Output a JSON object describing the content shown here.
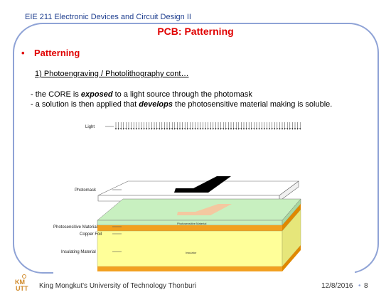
{
  "header": {
    "course": "EIE 211 Electronic Devices and Circuit Design II"
  },
  "slide": {
    "title": "PCB: Patterning",
    "bullet_marker": "•",
    "bullet": "Patterning",
    "subheading": "1)  Photoengraving / Photolithography cont…",
    "line1": {
      "prefix": "- the CORE is ",
      "emph": "exposed",
      "suffix": " to a light source through the photomask"
    },
    "line2": {
      "prefix": "- a solution is then applied that ",
      "emph": "develops",
      "suffix": " the photosensitive material making is soluble."
    }
  },
  "figure": {
    "labels": {
      "light": "Light",
      "photomask": "Photomask",
      "photosensitive": "Photosensitive Material",
      "copper": "Copper Foil",
      "insulating": "Insulating Material",
      "photosensitive_inner": "Photosensitive Material",
      "insulator_inner": "Insulator"
    },
    "colors": {
      "photosensitive": "#c8f0c0",
      "copper": "#f2a020",
      "insulator": "#ffff99",
      "trace": "#f4c8a0",
      "mask_pattern": "#000000"
    }
  },
  "footer": {
    "logo_text": "KMUTT",
    "university": "King Mongkut's University of Technology Thonburi",
    "date": "12/8/2016",
    "page_bullet": "•",
    "page": "8"
  }
}
